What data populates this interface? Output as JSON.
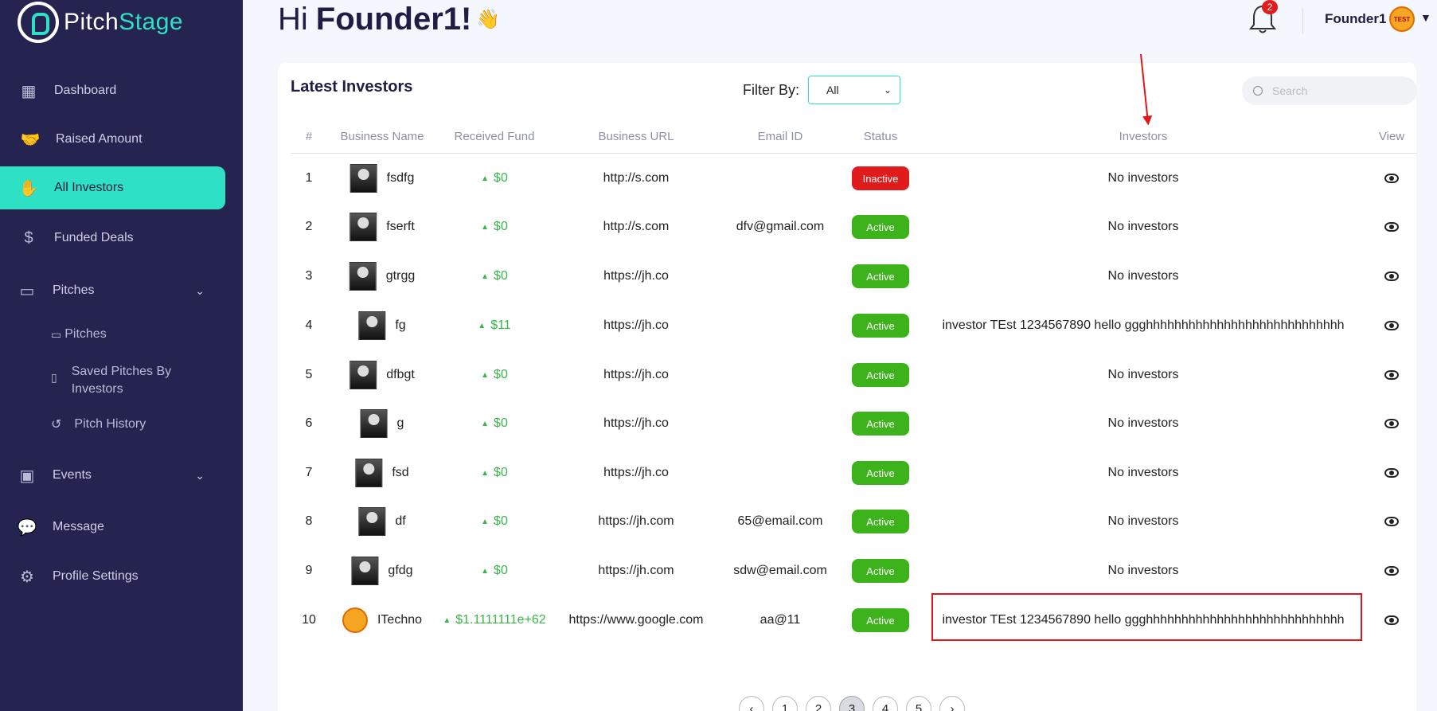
{
  "brand": {
    "name_part1": "Pitch",
    "name_part2": "Stage"
  },
  "sidebar": {
    "items": [
      {
        "label": "Dashboard",
        "icon": "dashboard-grid-icon"
      },
      {
        "label": "Raised Amount",
        "icon": "handshake-icon"
      },
      {
        "label": "All Investors",
        "icon": "investor-hand-icon",
        "active": true
      },
      {
        "label": "Funded Deals",
        "icon": "money-hand-icon"
      },
      {
        "label": "Pitches",
        "icon": "presentation-icon",
        "expandable": true
      },
      {
        "label": "Events",
        "icon": "calendar-icon",
        "expandable": true
      },
      {
        "label": "Message",
        "icon": "chat-icon"
      },
      {
        "label": "Profile Settings",
        "icon": "user-gear-icon"
      }
    ],
    "pitches_sub": [
      {
        "label": "Pitches",
        "icon": "presentation-small-icon"
      },
      {
        "label": "Saved Pitches By",
        "label2": "Investors",
        "icon": "bookmark-icon"
      },
      {
        "label": "Pitch History",
        "icon": "history-icon"
      }
    ]
  },
  "header": {
    "greeting": "Hi",
    "name": "Founder1!",
    "wave": "👋",
    "notification_count": "2",
    "user_name": "Founder1",
    "avatar_text": "TEST"
  },
  "card": {
    "title": "Latest Investors",
    "filter_label": "Filter By:",
    "filter_value": "All",
    "search_placeholder": "Search"
  },
  "table": {
    "columns": [
      "#",
      "Business Name",
      "Received Fund",
      "Business URL",
      "Email ID",
      "Status",
      "Investors",
      "View"
    ],
    "rows": [
      {
        "n": "1",
        "name": "fsdfg",
        "fund": "$0",
        "url": "http://s.com",
        "email": "",
        "status": "Inactive",
        "investors": "No investors"
      },
      {
        "n": "2",
        "name": "fserft",
        "fund": "$0",
        "url": "http://s.com",
        "email": "dfv@gmail.com",
        "status": "Active",
        "investors": "No investors"
      },
      {
        "n": "3",
        "name": "gtrgg",
        "fund": "$0",
        "url": "https://jh.co",
        "email": "",
        "status": "Active",
        "investors": "No investors"
      },
      {
        "n": "4",
        "name": "fg",
        "fund": "$11",
        "url": "https://jh.co",
        "email": "",
        "status": "Active",
        "investors": "investor TEst 1234567890 hello ggghhhhhhhhhhhhhhhhhhhhhhhhhhhh"
      },
      {
        "n": "5",
        "name": "dfbgt",
        "fund": "$0",
        "url": "https://jh.co",
        "email": "",
        "status": "Active",
        "investors": "No investors"
      },
      {
        "n": "6",
        "name": "g",
        "fund": "$0",
        "url": "https://jh.co",
        "email": "",
        "status": "Active",
        "investors": "No investors"
      },
      {
        "n": "7",
        "name": "fsd",
        "fund": "$0",
        "url": "https://jh.co",
        "email": "",
        "status": "Active",
        "investors": "No investors"
      },
      {
        "n": "8",
        "name": "df",
        "fund": "$0",
        "url": "https://jh.com",
        "email": "65@email.com",
        "status": "Active",
        "investors": "No investors"
      },
      {
        "n": "9",
        "name": "gfdg",
        "fund": "$0",
        "url": "https://jh.com",
        "email": "sdw@email.com",
        "status": "Active",
        "investors": "No investors"
      },
      {
        "n": "10",
        "name": "ITechno",
        "fund": "$1.1111111e+62",
        "url": "https://www.google.com",
        "email": "aa@11",
        "status": "Active",
        "investors": "investor TEst 1234567890 hello ggghhhhhhhhhhhhhhhhhhhhhhhhhhhh"
      }
    ]
  },
  "pagination": {
    "prev": "‹",
    "pages": [
      "1",
      "2",
      "3",
      "4",
      "5"
    ],
    "current": "3",
    "next": "›"
  },
  "colors": {
    "sidebar": "#25234f",
    "accent": "#2ee0c4",
    "active_badge": "#3cb31a",
    "inactive_badge": "#e01b1b",
    "annotation": "#e0161c"
  }
}
